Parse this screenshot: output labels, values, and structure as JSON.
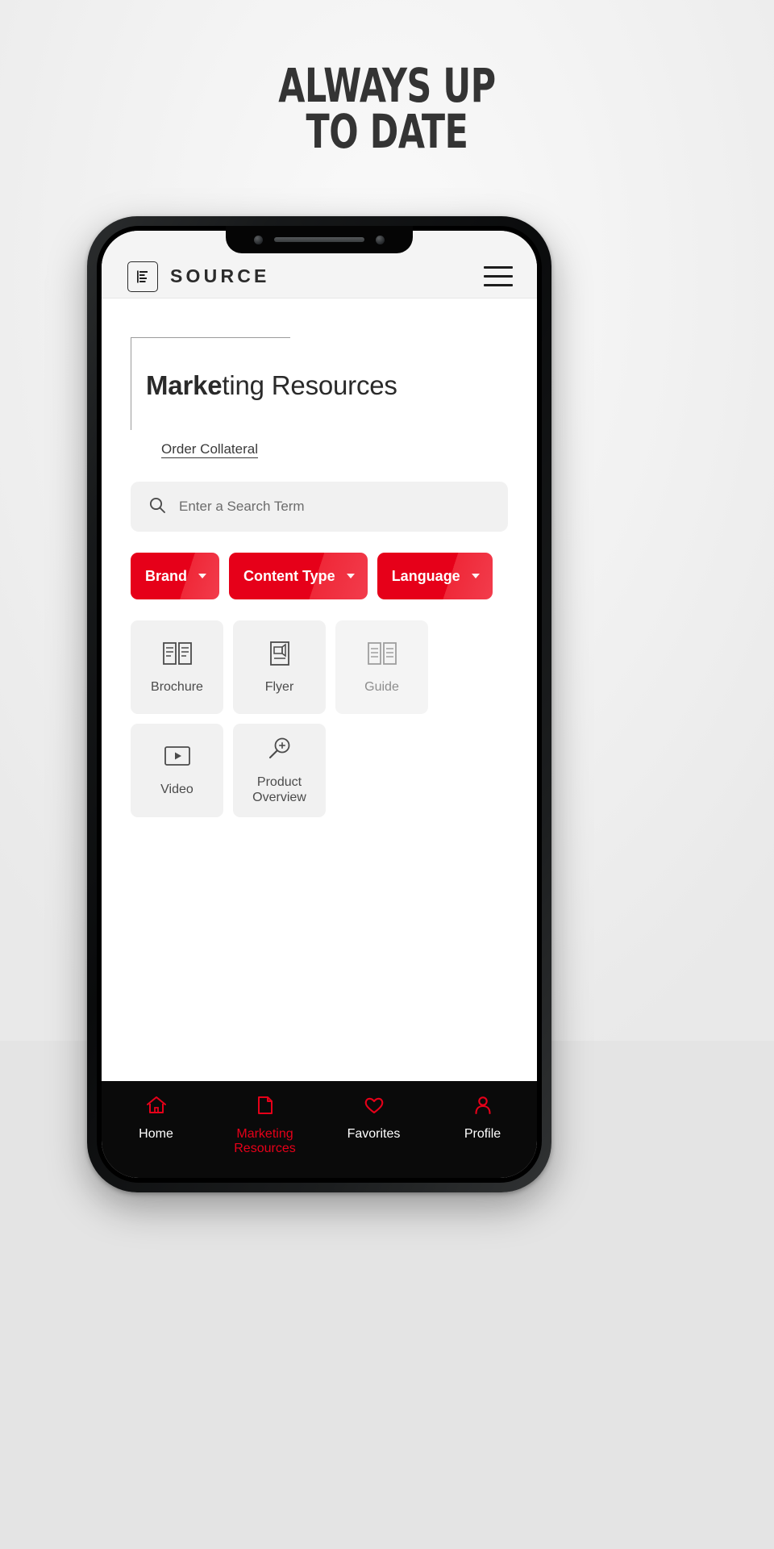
{
  "promo": {
    "headline_line1": "ALWAYS UP",
    "headline_line2": "TO DATE"
  },
  "app": {
    "header": {
      "brand_name": "SOURCE",
      "logo_icon": "document-lines-icon",
      "menu_icon": "hamburger-menu-icon"
    },
    "page": {
      "title_bold": "Marke",
      "title_rest": "ting Resources",
      "title_full": "Marketing Resources",
      "order_link": "Order Collateral"
    },
    "search": {
      "placeholder": "Enter a Search Term",
      "value": "",
      "icon": "search-icon"
    },
    "filters": [
      {
        "label": "Brand",
        "icon": "chevron-down-icon"
      },
      {
        "label": "Content Type",
        "icon": "chevron-down-icon"
      },
      {
        "label": "Language",
        "icon": "chevron-down-icon"
      }
    ],
    "tiles": [
      {
        "label": "Brochure",
        "icon": "open-book-icon",
        "dim": false
      },
      {
        "label": "Flyer",
        "icon": "flyer-page-icon",
        "dim": false
      },
      {
        "label": "Guide",
        "icon": "guide-book-icon",
        "dim": true
      },
      {
        "label": "Video",
        "icon": "play-video-icon",
        "dim": false
      },
      {
        "label": "Product Overview",
        "icon": "magnifier-plus-icon",
        "dim": false
      }
    ],
    "bottom_nav": [
      {
        "label": "Home",
        "icon": "home-icon",
        "active": false
      },
      {
        "label": "Marketing Resources",
        "icon": "folder-icon",
        "active": true
      },
      {
        "label": "Favorites",
        "icon": "heart-icon",
        "active": false
      },
      {
        "label": "Profile",
        "icon": "person-icon",
        "active": false
      }
    ]
  },
  "colors": {
    "brand_red": "#e60019",
    "nav_background": "#0a0a0a",
    "text_dark": "#2a2a2a",
    "tile_background": "#f1f1f1"
  }
}
